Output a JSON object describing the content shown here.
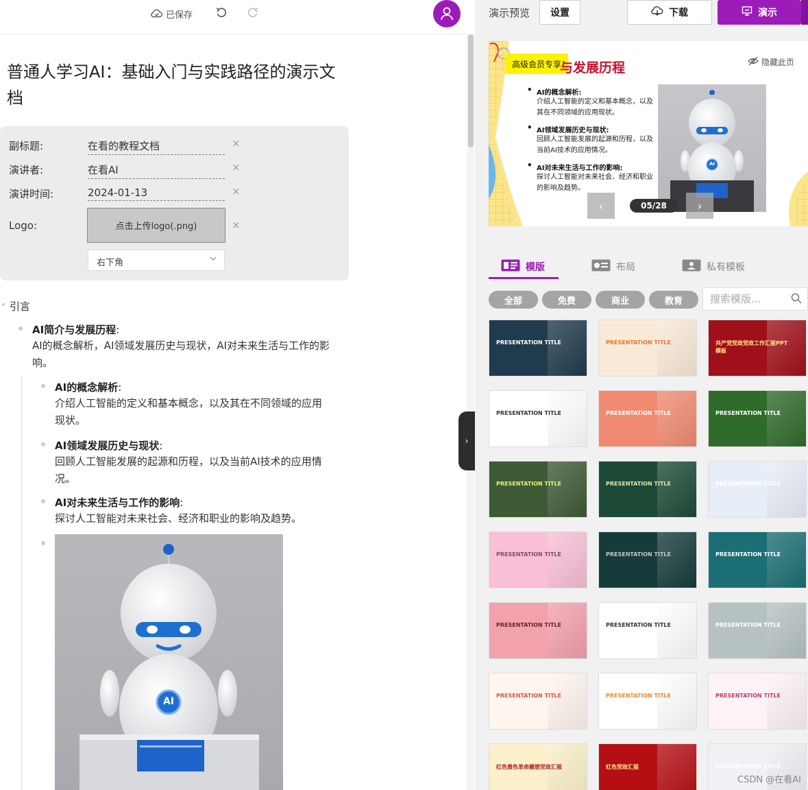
{
  "editor": {
    "saved_label": "已保存",
    "doc_title": "普通人学习AI：基础入门与实践路径的演示文档",
    "meta": {
      "subtitle_label": "副标题:",
      "subtitle_value": "在看的教程文档",
      "speaker_label": "演讲者:",
      "speaker_value": "在看AI",
      "time_label": "演讲时间:",
      "time_value": "2024-01-13",
      "logo_label": "Logo:",
      "logo_button": "点击上传logo(.png)",
      "logo_position": "右下角",
      "clear_glyph": "×"
    },
    "outline": {
      "heading": "引言",
      "section_title": "AI简介与发展历程",
      "section_colon": ":",
      "section_desc": "AI的概念解析，AI领域发展历史与现状，AI对未来生活与工作的影响。",
      "items": [
        {
          "title": "AI的概念解析",
          "desc": "介绍人工智能的定义和基本概念，以及其在不同领域的应用现状。"
        },
        {
          "title": "AI领域发展历史与现状",
          "desc": "回顾人工智能发展的起源和历程，以及当前AI技术的应用情况。"
        },
        {
          "title": "AI对未来生活与工作的影响",
          "desc": "探讨人工智能对未来社会、经济和职业的影响及趋势。"
        }
      ],
      "robot_badge": "AI"
    }
  },
  "panel": {
    "preview_label": "演示预览",
    "settings_button": "设置",
    "download_button": "下载",
    "present_button": "演示",
    "slide": {
      "vip_badge": "高级会员专享",
      "title": "与发展历程",
      "hide_page": "隐藏此页",
      "bullets": [
        {
          "title": "AI的概念解析:",
          "desc": "介绍人工智能的定义和基本概念，以及其在不同领域的应用现状。"
        },
        {
          "title": "AI领域发展历史与现状:",
          "desc": "回顾人工智能发展的起源和历程，以及当前AI技术的应用情况。"
        },
        {
          "title": "AI对未来生活与工作的影响:",
          "desc": "探讨人工智能对未来社会、经济和职业的影响及趋势。"
        }
      ],
      "page_indicator": "05/28",
      "robot_badge": "AI"
    },
    "tabs": [
      {
        "label": "模版",
        "active": true
      },
      {
        "label": "布局",
        "active": false
      },
      {
        "label": "私有模板",
        "active": false
      }
    ],
    "filters": [
      "全部",
      "免费",
      "商业",
      "教育"
    ],
    "search_placeholder": "搜索模版...",
    "templates": [
      {
        "title": "PRESENTATION TITLE",
        "bg": "#1f3b4d",
        "fg": "#ffffff"
      },
      {
        "title": "PRESENTATION TITLE",
        "bg": "#fbe9d7",
        "fg": "#d97a3a"
      },
      {
        "title": "共产党党政党政工作汇报PPT模板",
        "bg": "#a0101a",
        "fg": "#ffe38a"
      },
      {
        "title": "PRESENTATION TITLE",
        "bg": "#ffffff",
        "fg": "#333333"
      },
      {
        "title": "PRESENTATION TITLE",
        "bg": "#f08b72",
        "fg": "#ffffff"
      },
      {
        "title": "PRESENTATION TITLE",
        "bg": "#2f6b2a",
        "fg": "#ffffff"
      },
      {
        "title": "PRESENTATION TITLE",
        "bg": "#3d5a34",
        "fg": "#e6f27a"
      },
      {
        "title": "PRESENTATION TITLE",
        "bg": "#1d4a37",
        "fg": "#e6e3a6"
      },
      {
        "title": "PRESENTATION TITLE",
        "bg": "#e8eef8",
        "fg": "#ffffff"
      },
      {
        "title": "PRESENTATION TITLE",
        "bg": "#f8bfd6",
        "fg": "#8a4a5a"
      },
      {
        "title": "PRESENTATION TITLE",
        "bg": "#163b3b",
        "fg": "#c0c7c7"
      },
      {
        "title": "PRESENTATION TITLE",
        "bg": "#1b6e73",
        "fg": "#ffffff"
      },
      {
        "title": "PRESENTATION TITLE",
        "bg": "#f3a1ad",
        "fg": "#6a1e2e"
      },
      {
        "title": "PRESENTATION TITLE",
        "bg": "#ffffff",
        "fg": "#333333"
      },
      {
        "title": "PRESENTATION TITLE",
        "bg": "#b6c2c2",
        "fg": "#ffffff"
      },
      {
        "title": "PRESENTATION TITLE",
        "bg": "#fff5ef",
        "fg": "#e0553a"
      },
      {
        "title": "PRESENTATION TITLE",
        "bg": "#ffffff",
        "fg": "#f08a2a"
      },
      {
        "title": "PRESENTATION TITLE",
        "bg": "#fdf3f7",
        "fg": "#c63a6b"
      },
      {
        "title": "红色黄色革命雕塑党政汇报",
        "bg": "#fbf0c9",
        "fg": "#b3261e"
      },
      {
        "title": "红色党政汇报",
        "bg": "#b50f14",
        "fg": "#ffe08a"
      },
      {
        "title": "PRESENTATION TITLE",
        "bg": "#f2eff5",
        "fg": "#ffffff"
      }
    ]
  },
  "watermark": "CSDN @在看AI",
  "colors": {
    "accent": "#9b1cb8",
    "vip": "#fff200",
    "slide_title": "#c8102e"
  }
}
